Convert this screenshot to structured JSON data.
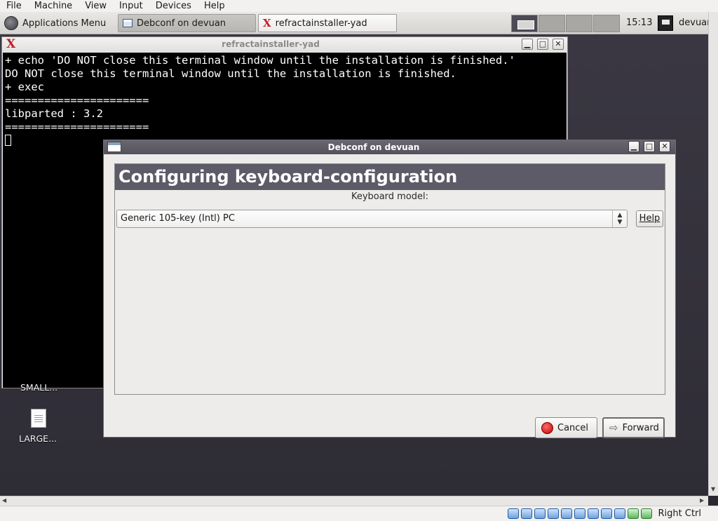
{
  "host_menu": [
    "File",
    "Machine",
    "View",
    "Input",
    "Devices",
    "Help"
  ],
  "panel": {
    "apps_menu_label": "Applications Menu",
    "tasks": [
      {
        "label": "Debconf on devuan",
        "active": true
      },
      {
        "label": "refractainstaller-yad",
        "active": false
      }
    ],
    "workspaces": 4,
    "clock": "15:13",
    "user": "devuan"
  },
  "terminal": {
    "title": "refractainstaller-yad",
    "lines": [
      "+ echo 'DO NOT close this terminal window until the installation is finished.'",
      "DO NOT close this terminal window until the installation is finished.",
      "+ exec",
      "======================",
      "libparted : 3.2",
      "======================"
    ]
  },
  "desktop_icons": [
    {
      "label": "SMALL..."
    },
    {
      "label": "LARGE..."
    }
  ],
  "dialog": {
    "title": "Debconf on devuan",
    "heading": "Configuring keyboard-configuration",
    "field_label": "Keyboard model:",
    "selected_value": "Generic 105-key (Intl) PC",
    "help_label": "Help",
    "cancel_label": "Cancel",
    "forward_label": "Forward"
  },
  "statusbar": {
    "host_key": "Right Ctrl"
  },
  "colors": {
    "dialog_titlebar": "#55525c",
    "heading_bg": "#5e5b68",
    "desktop_bg": "#2e2c35",
    "terminal_bg": "#000000"
  }
}
